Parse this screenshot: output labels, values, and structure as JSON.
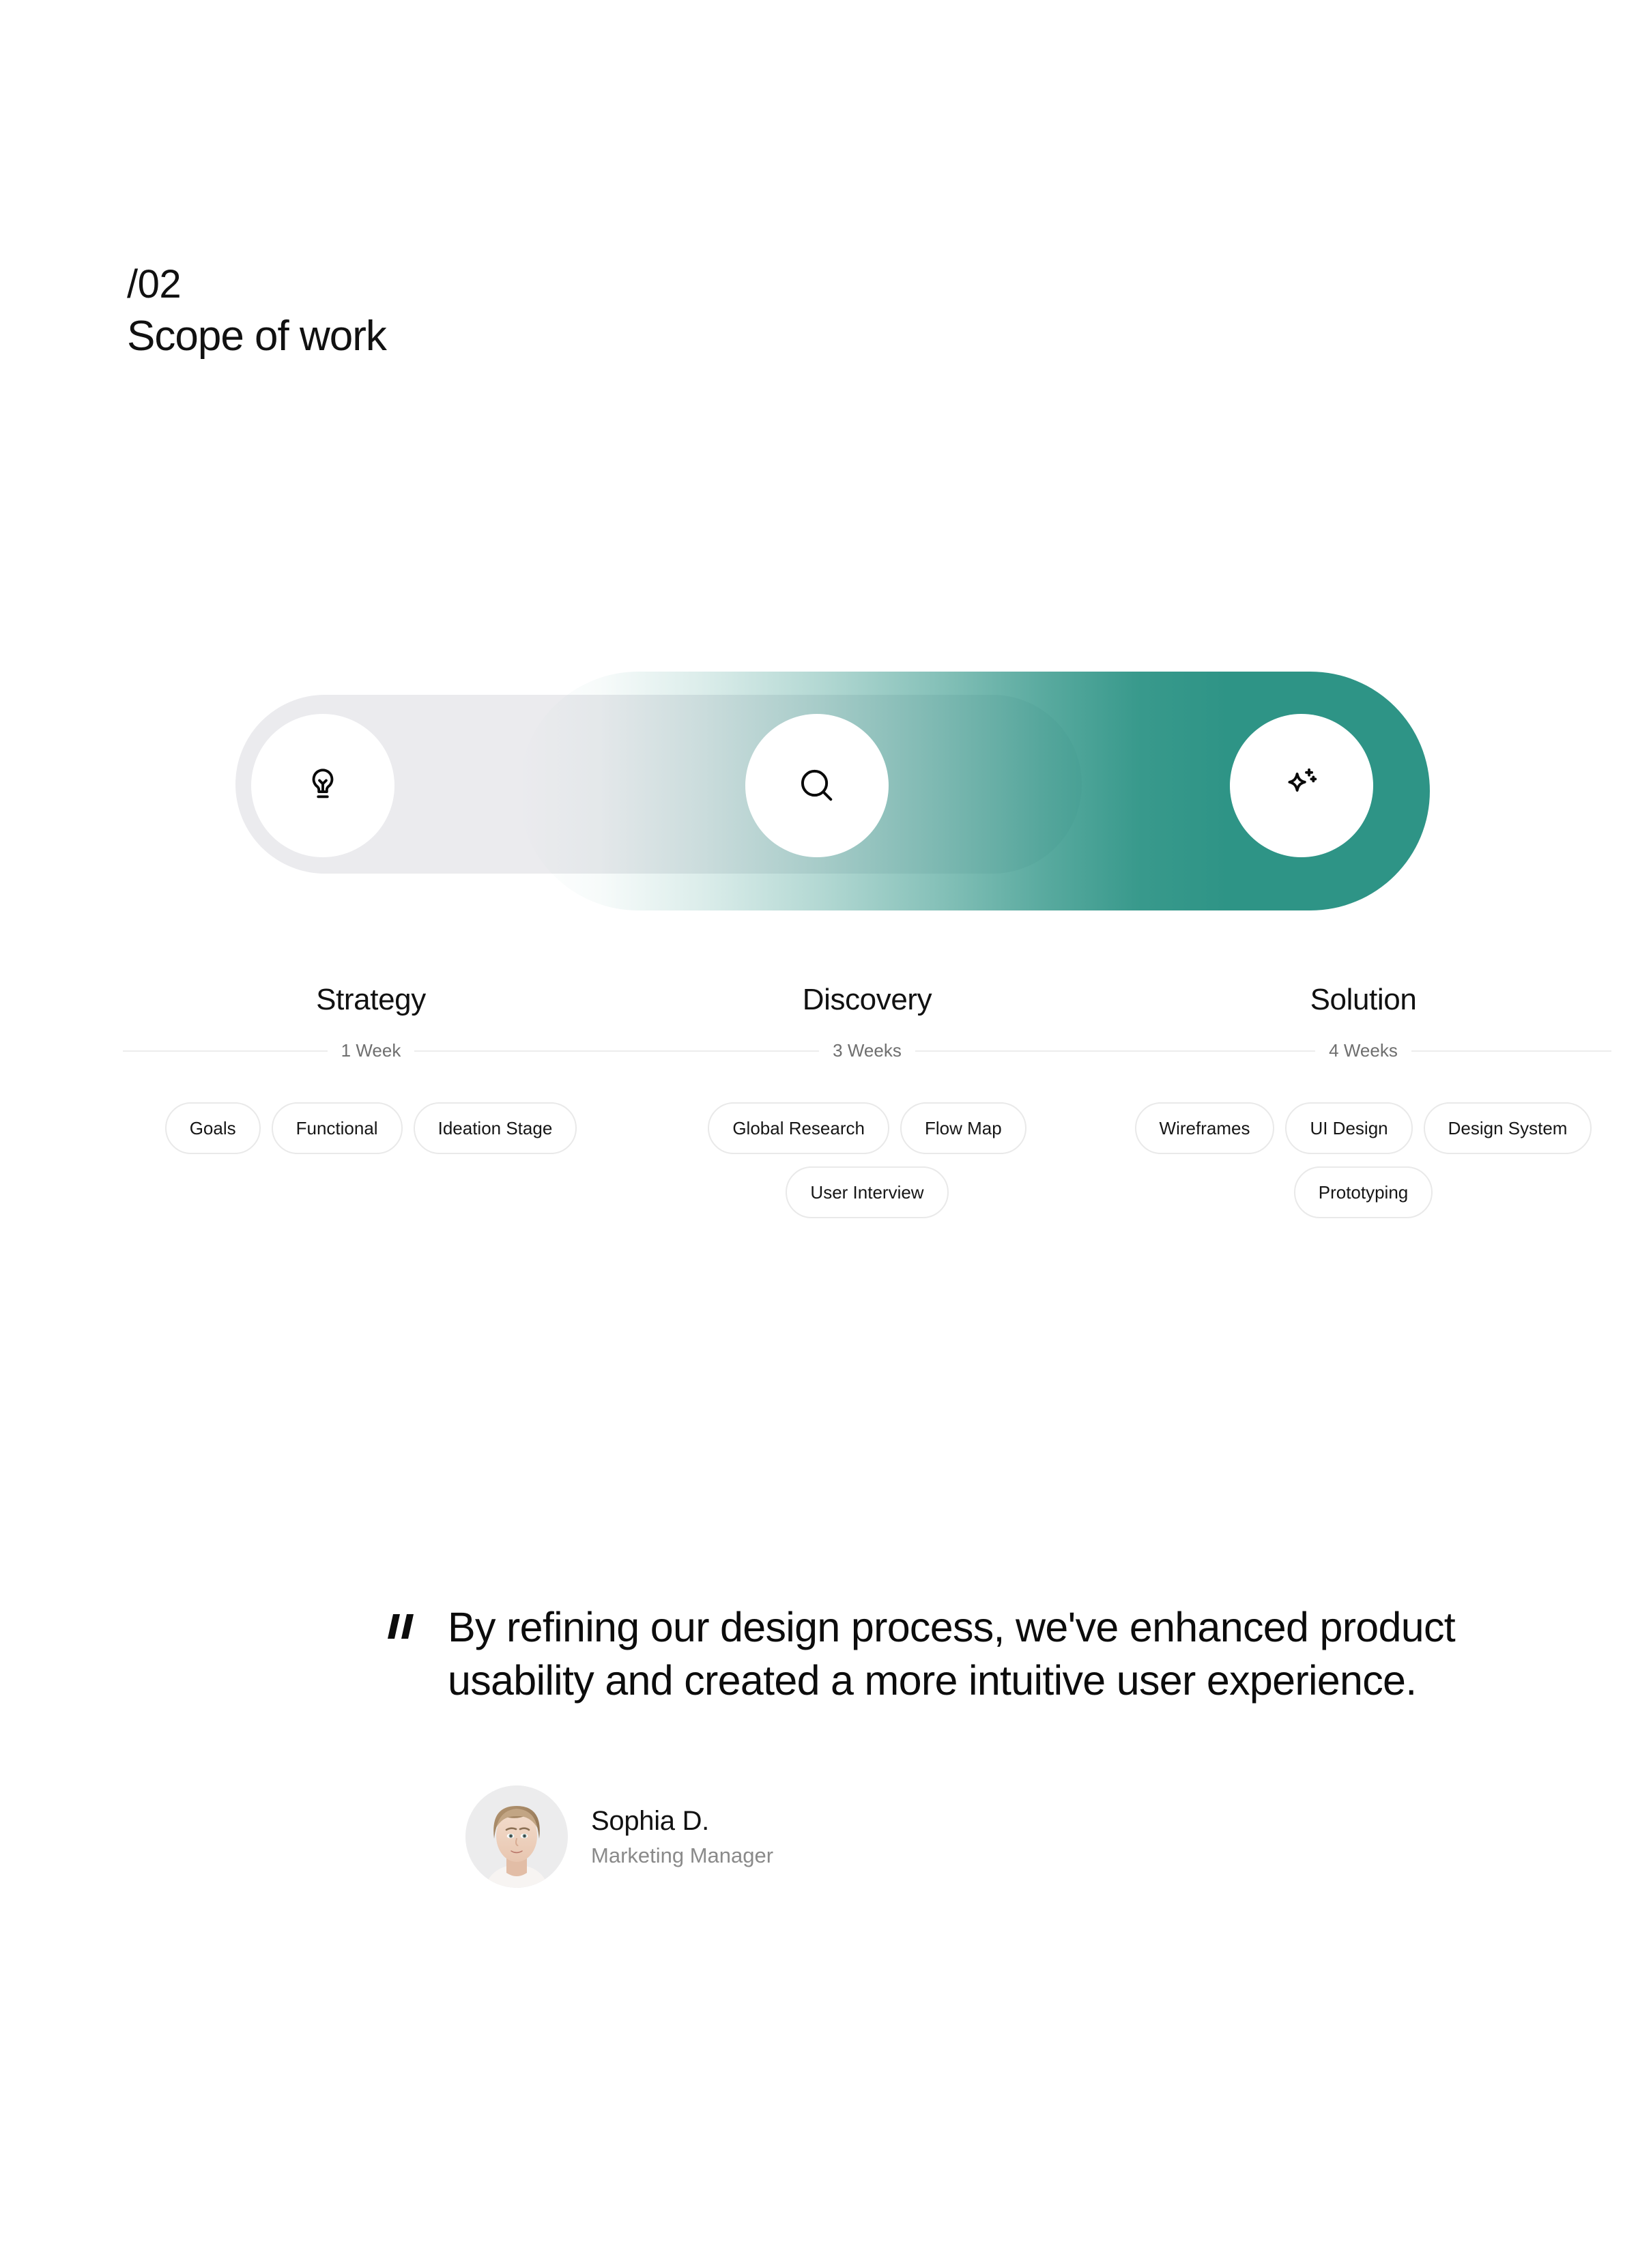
{
  "header": {
    "number": "/02",
    "title": "Scope of work"
  },
  "progress": {
    "stages": [
      {
        "icon": "lightbulb-icon",
        "state": "inactive"
      },
      {
        "icon": "search-icon",
        "state": "mid"
      },
      {
        "icon": "sparkle-icon",
        "state": "active"
      }
    ],
    "colors": {
      "accent": "#2E9486",
      "track_inactive": "#EBEBEE",
      "knob": "#FFFFFF"
    }
  },
  "columns": [
    {
      "title": "Strategy",
      "duration": "1 Week",
      "tags": [
        "Goals",
        "Functional",
        "Ideation Stage"
      ]
    },
    {
      "title": "Discovery",
      "duration": "3 Weeks",
      "tags": [
        "Global Research",
        "Flow Map",
        "User Interview"
      ]
    },
    {
      "title": "Solution",
      "duration": "4 Weeks",
      "tags": [
        "Wireframes",
        "UI Design",
        "Design System",
        "Prototyping"
      ]
    }
  ],
  "quote": {
    "mark": "quote-icon",
    "text": "By refining our design process, we've enhanced product usability and created a more intuitive user experience.",
    "author": {
      "avatar": "avatar",
      "name": "Sophia D.",
      "role": "Marketing Manager"
    }
  }
}
